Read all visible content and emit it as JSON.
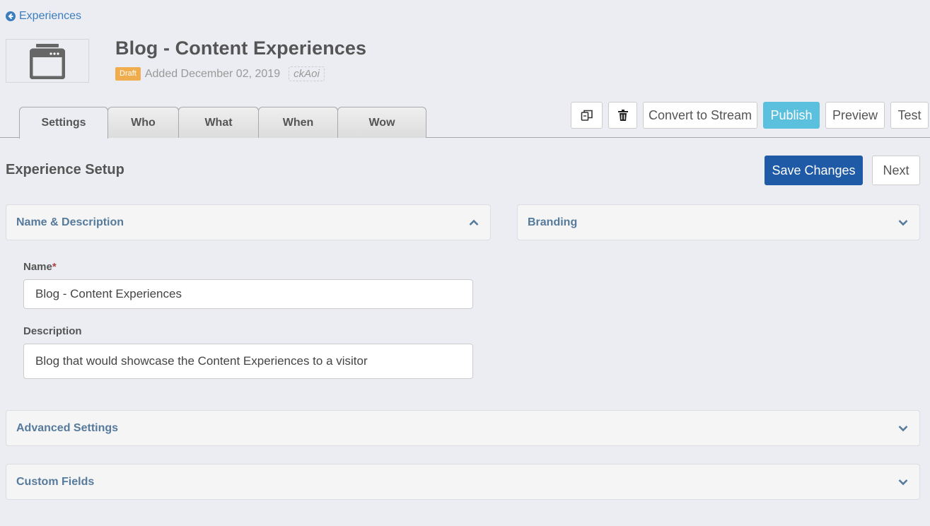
{
  "nav": {
    "back_label": "Experiences"
  },
  "header": {
    "title": "Blog - Content Experiences",
    "status_badge": "Draft",
    "added_text": "Added December 02, 2019",
    "code": "ckAoi"
  },
  "tabs": [
    {
      "label": "Settings",
      "active": true
    },
    {
      "label": "Who",
      "active": false
    },
    {
      "label": "What",
      "active": false
    },
    {
      "label": "When",
      "active": false
    },
    {
      "label": "Wow",
      "active": false
    }
  ],
  "toolbar": {
    "copy_icon": "copy-icon",
    "delete_icon": "trash-icon",
    "convert_label": "Convert to Stream",
    "publish_label": "Publish",
    "preview_label": "Preview",
    "test_label": "Test"
  },
  "section": {
    "title": "Experience Setup",
    "save_label": "Save Changes",
    "next_label": "Next"
  },
  "panels": {
    "name_description": {
      "label": "Name & Description",
      "expanded": true
    },
    "branding": {
      "label": "Branding",
      "expanded": false
    },
    "advanced": {
      "label": "Advanced Settings",
      "expanded": false
    },
    "custom_fields": {
      "label": "Custom Fields",
      "expanded": false
    }
  },
  "form": {
    "name_label": "Name",
    "name_required_mark": "*",
    "name_value": "Blog - Content Experiences",
    "description_label": "Description",
    "description_value": "Blog that would showcase the Content Experiences to a visitor"
  },
  "colors": {
    "accent": "#3b7dbf",
    "draft_badge": "#f0ad4e",
    "publish": "#5bc0de",
    "save": "#1f5aa6",
    "panel_label": "#567a9c"
  }
}
